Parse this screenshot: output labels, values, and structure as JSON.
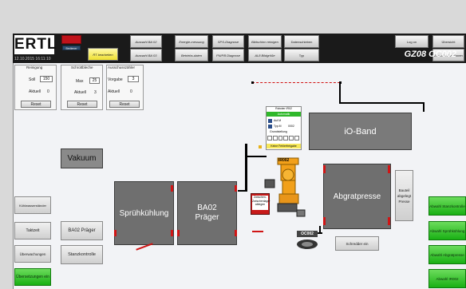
{
  "header": {
    "logo": "ERTL",
    "datetime": "12.10.2015 16:11:10",
    "status_label": "Bediener",
    "machine_id": "GZ08 OC002",
    "buttons": [
      {
        "id": "rt-bearbeiten",
        "label": "RT bearbeiten",
        "style": "yellow"
      },
      {
        "id": "auswahl-ba02",
        "label": "Auswahl BA 02"
      },
      {
        "id": "auswahl-ba03",
        "label": "Auswahl BA 03"
      },
      {
        "id": "energie-messung",
        "label": "Energie-messung"
      },
      {
        "id": "betriebs-daten",
        "label": "Betriebs-daten"
      },
      {
        "id": "sps-diagnose",
        "label": "SPS-Diagnose"
      },
      {
        "id": "pnpb-diagnose",
        "label": "PN/PB Diagnose"
      },
      {
        "id": "bildschirm-reinigen",
        "label": "Bildschirm reinigen"
      },
      {
        "id": "al8-bildgroesse",
        "label": "AL8 Bildgröße"
      },
      {
        "id": "datenschieben",
        "label": "Datenschieben"
      },
      {
        "id": "typ",
        "label": "Typ"
      },
      {
        "id": "log-on",
        "label": "Log on"
      },
      {
        "id": "uebersicht",
        "label": "Übersicht"
      },
      {
        "id": "zentrale-funktionen",
        "label": "Zentrale Funktionen"
      }
    ]
  },
  "panels": {
    "reinigung": {
      "title": "Reinigung",
      "soll_label": "Soll",
      "soll_value": "150",
      "aktuell_label": "Aktuell",
      "aktuell_value": "0",
      "reset": "Reset"
    },
    "schrottbleche": {
      "title": "Schrottbleche",
      "max_label": "Max",
      "max_value": "25",
      "aktuell_label": "Aktuell",
      "aktuell_value": "3",
      "reset": "Reset"
    },
    "ausschusszaehler": {
      "title": "Ausschusszähler",
      "vorgabe_label": "Vorgabe",
      "vorgabe_value": "3",
      "aktuell_label": "Aktuell",
      "aktuell_value": "0",
      "reset": "Reset"
    }
  },
  "machines": {
    "vakuum": "Vakuum",
    "spruehkuehlung": "Sprühkühlung",
    "ba02_praeger": "BA02\nPräger",
    "io_band": "iO-Band",
    "abgratpresse": "Abgratpresse",
    "ir002": "IR002",
    "oc002": "OC002"
  },
  "robot_panel": {
    "title": "Roboter IR02",
    "status": "Automatik",
    "rows": [
      "Auf.M",
      "Typ.M"
    ],
    "typ_value": "0002",
    "grundstellung": "Grundstellung",
    "footer": "Keine Fehlerfreigabe"
  },
  "zwischen": {
    "line1": "Zwischen-",
    "line2": "Zwischenlager",
    "line3": "ablegen"
  },
  "left_buttons": [
    {
      "id": "kuehlwasserstaender",
      "label": "Kühlwasserständer"
    },
    {
      "id": "taktzeit",
      "label": "Taktzeit"
    },
    {
      "id": "ueberwachungen",
      "label": "Überwachungen"
    },
    {
      "id": "uebersetzungen-ein",
      "label": "Übersetzungen ein"
    }
  ],
  "center_buttons": [
    {
      "id": "ba02-praeger-btn",
      "label": "BA02 Präger"
    },
    {
      "id": "stanzkontrolle",
      "label": "Stanzkontrolle"
    }
  ],
  "bauteil_button": "Bauteil abgelegt Presse",
  "schredder_button": "Schredder ein",
  "right_green": [
    {
      "id": "abwahl-stanzkontrolle",
      "label": "Abwahl Stanzkontrolle"
    },
    {
      "id": "abwahl-spruehkuehlung",
      "label": "Abwahl Sprühkühlung"
    },
    {
      "id": "abwahl-abgratpresse",
      "label": "Abwahl Abgratpresse"
    },
    {
      "id": "abwahl-ir002",
      "label": "Abwahl IR002"
    }
  ],
  "colors": {
    "accent_red": "#d01515",
    "green": "#19b014",
    "robot_orange": "#f2a01a",
    "header": "#1a1a1a"
  }
}
